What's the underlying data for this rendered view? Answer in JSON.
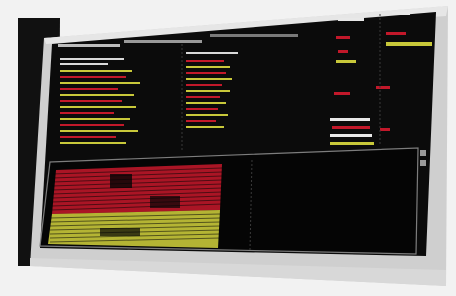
{
  "scene": {
    "description_visible_text": [],
    "colors": {
      "background": "#f2f2f2",
      "bezel": "#cfcfcf",
      "screen": "#0b0b0b",
      "red": "#c2182a",
      "yellow": "#c8c83a",
      "white": "#e8e8e8",
      "divider": "#7d7d7d"
    }
  }
}
